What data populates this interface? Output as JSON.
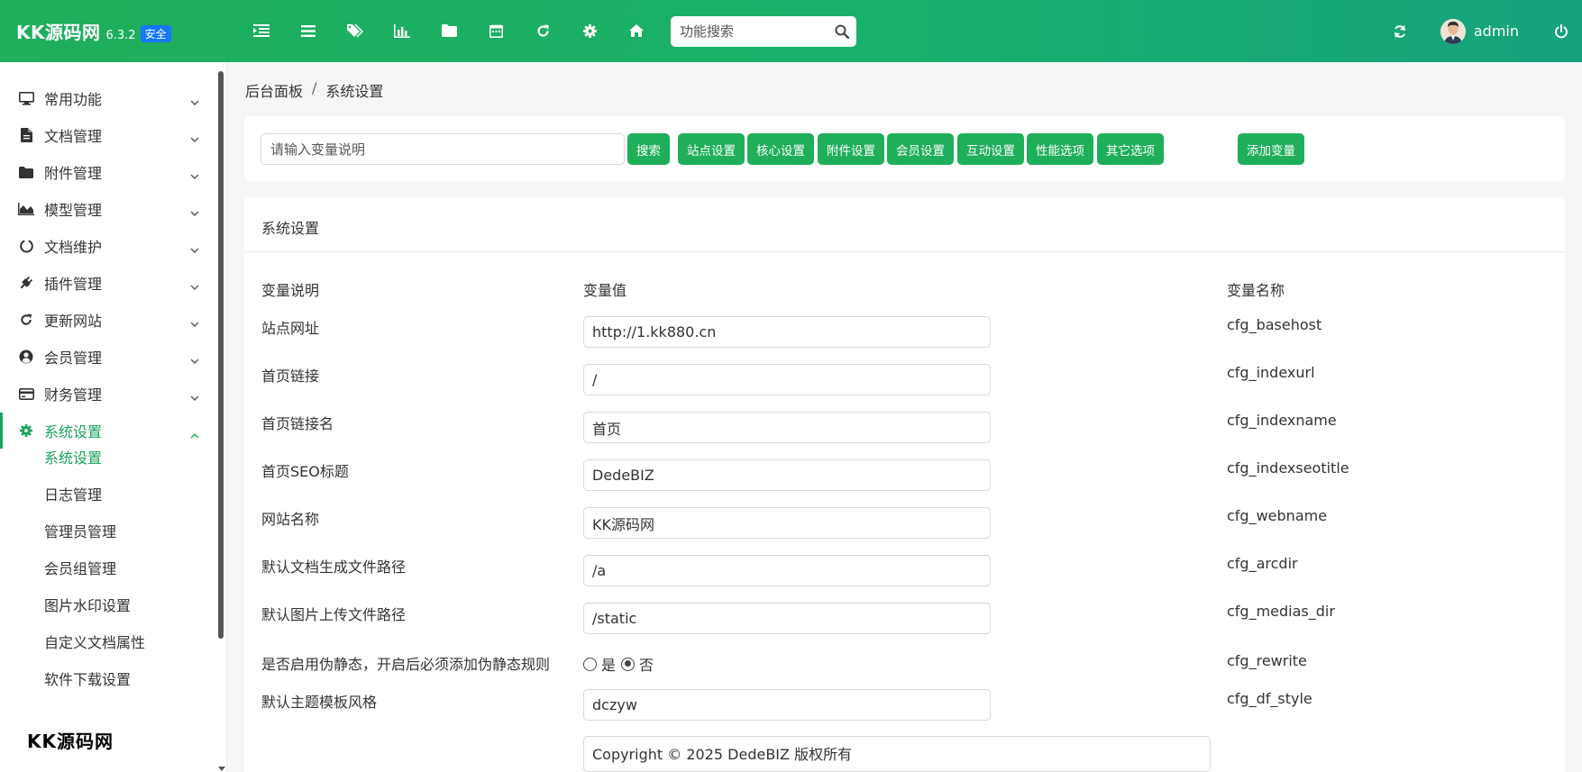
{
  "app": {
    "name": "KK源码网",
    "version": "6.3.2",
    "badge": "安全"
  },
  "header": {
    "toolbar_icons": [
      "indent-icon",
      "list-icon",
      "tags-icon",
      "bar-chart-icon",
      "folder-icon",
      "calendar-icon",
      "refresh-icon",
      "gear-icon",
      "home-icon"
    ],
    "search_placeholder": "功能搜索",
    "user": "admin"
  },
  "sidebar": {
    "items": [
      {
        "label": "常用功能",
        "icon": "monitor-icon"
      },
      {
        "label": "文档管理",
        "icon": "file-icon"
      },
      {
        "label": "附件管理",
        "icon": "folder-icon"
      },
      {
        "label": "模型管理",
        "icon": "area-chart-icon"
      },
      {
        "label": "文档维护",
        "icon": "circle-notch-icon"
      },
      {
        "label": "插件管理",
        "icon": "plug-icon"
      },
      {
        "label": "更新网站",
        "icon": "refresh-icon"
      },
      {
        "label": "会员管理",
        "icon": "user-circle-icon"
      },
      {
        "label": "财务管理",
        "icon": "credit-card-icon"
      },
      {
        "label": "系统设置",
        "icon": "gear-icon"
      }
    ],
    "subitems": [
      "系统设置",
      "日志管理",
      "管理员管理",
      "会员组管理",
      "图片水印设置",
      "自定义文档属性",
      "软件下载设置"
    ],
    "watermark": "KK源码网"
  },
  "breadcrumb": {
    "root": "后台面板",
    "separator": "/",
    "current": "系统设置"
  },
  "filter": {
    "placeholder": "请输入变量说明",
    "buttons": [
      "搜索",
      "站点设置",
      "核心设置",
      "附件设置",
      "会员设置",
      "互动设置",
      "性能选项",
      "其它选项",
      "添加变量"
    ]
  },
  "panel": {
    "title": "系统设置",
    "columns": [
      "变量说明",
      "变量值",
      "变量名称"
    ],
    "rows": [
      {
        "label": "站点网址",
        "value": "http://1.kk880.cn",
        "name": "cfg_basehost"
      },
      {
        "label": "首页链接",
        "value": "/",
        "name": "cfg_indexurl"
      },
      {
        "label": "首页链接名",
        "value": "首页",
        "name": "cfg_indexname"
      },
      {
        "label": "首页SEO标题",
        "value": "DedeBIZ",
        "name": "cfg_indexseotitle"
      },
      {
        "label": "网站名称",
        "value": "KK源码网",
        "name": "cfg_webname"
      },
      {
        "label": "默认文档生成文件路径",
        "value": "/a",
        "name": "cfg_arcdir"
      },
      {
        "label": "默认图片上传文件路径",
        "value": "/static",
        "name": "cfg_medias_dir"
      },
      {
        "label": "是否启用伪静态，开启后必须添加伪静态规则",
        "radio_yes": "是",
        "radio_no": "否",
        "selected": "否",
        "name": "cfg_rewrite"
      },
      {
        "label": "默认主题模板风格",
        "value": "dczyw",
        "name": "cfg_df_style"
      },
      {
        "value": "Copyright © 2025 DedeBIZ 版权所有"
      }
    ]
  },
  "colors": {
    "primary": "#1fae5a",
    "badge": "#1677ff"
  }
}
